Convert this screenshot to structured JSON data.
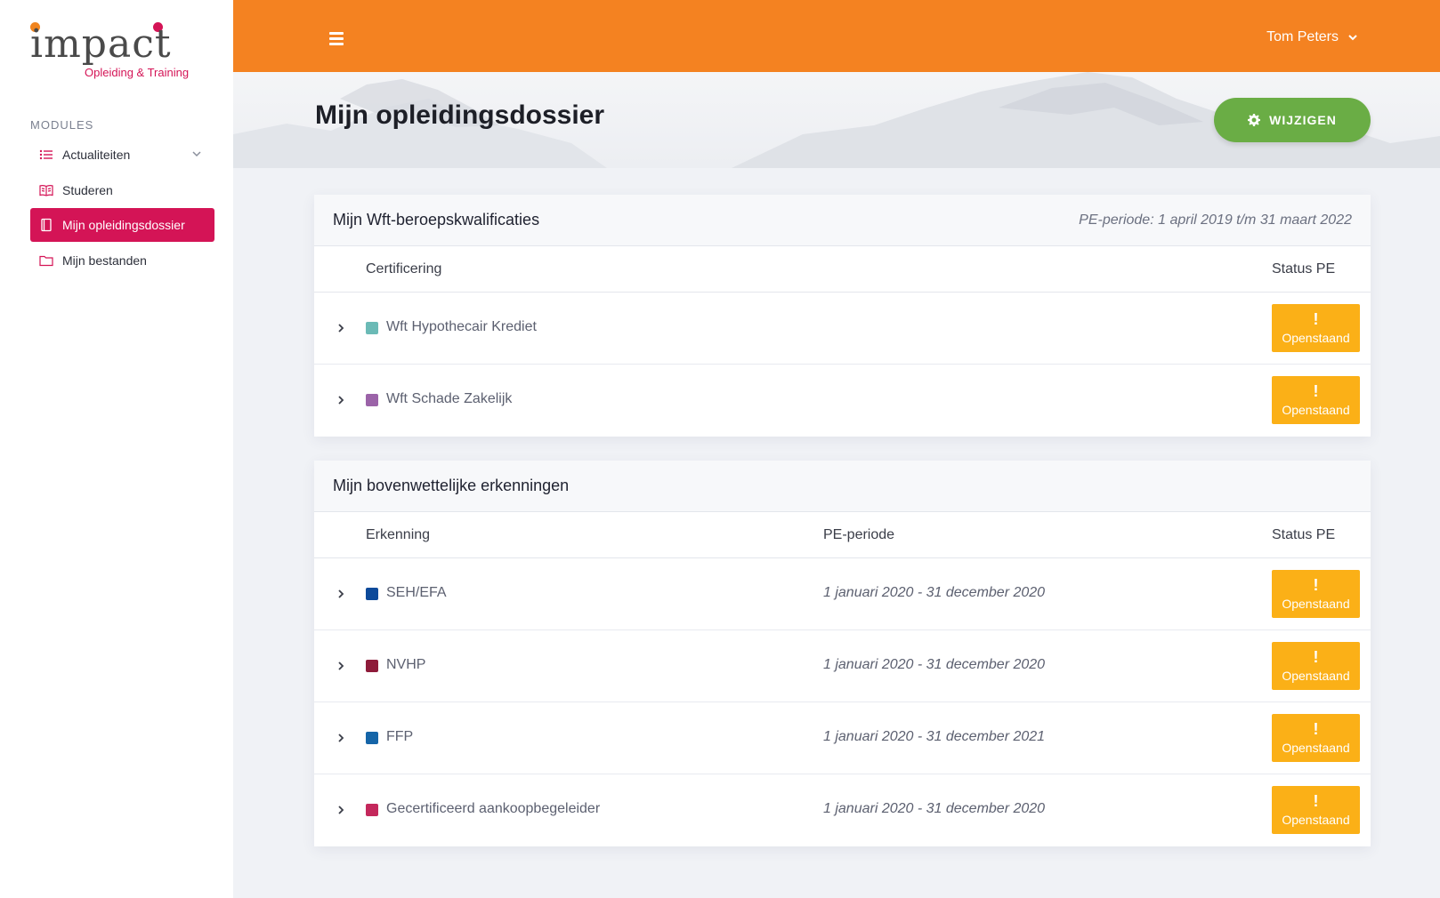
{
  "brand": {
    "logo_word": "impact",
    "logo_sub": "Opleiding & Training"
  },
  "sidebar": {
    "section_label": "MODULES",
    "items": [
      {
        "label": "Actualiteiten",
        "icon": "list-icon",
        "active": false,
        "expandable": true
      },
      {
        "label": "Studeren",
        "icon": "book-icon",
        "active": false
      },
      {
        "label": "Mijn opleidingsdossier",
        "icon": "notebook-icon",
        "active": true
      },
      {
        "label": "Mijn bestanden",
        "icon": "folder-icon",
        "active": false
      }
    ]
  },
  "topbar": {
    "user_name": "Tom Peters"
  },
  "header": {
    "title": "Mijn opleidingsdossier",
    "edit_button": "WIJZIGEN"
  },
  "qualifications": {
    "title": "Mijn Wft-beroepskwalificaties",
    "period": "PE-periode: 1 april 2019 t/m 31 maart 2022",
    "col_name": "Certificering",
    "col_status": "Status PE",
    "rows": [
      {
        "name": "Wft Hypothecair Krediet",
        "color": "#6bbab6",
        "status_icon": "!",
        "status": "Openstaand"
      },
      {
        "name": "Wft Schade Zakelijk",
        "color": "#9b63a8",
        "status_icon": "!",
        "status": "Openstaand"
      }
    ]
  },
  "recognitions": {
    "title": "Mijn bovenwettelijke erkenningen",
    "col_name": "Erkenning",
    "col_period": "PE-periode",
    "col_status": "Status PE",
    "rows": [
      {
        "name": "SEH/EFA",
        "color": "#0d4a9a",
        "period": "1 januari 2020 - 31 december 2020",
        "status_icon": "!",
        "status": "Openstaand"
      },
      {
        "name": "NVHP",
        "color": "#8e1b3a",
        "period": "1 januari 2020 - 31 december 2020",
        "status_icon": "!",
        "status": "Openstaand"
      },
      {
        "name": "FFP",
        "color": "#1565a8",
        "period": "1 januari 2020 - 31 december 2021",
        "status_icon": "!",
        "status": "Openstaand"
      },
      {
        "name": "Gecertificeerd aankoopbegeleider",
        "color": "#c4285c",
        "period": "1 januari 2020 - 31 december 2020",
        "status_icon": "!",
        "status": "Openstaand"
      }
    ]
  },
  "colors": {
    "orange": "#f48221",
    "brand_red": "#d41456",
    "green": "#6aad45",
    "status_yellow": "#fbb017"
  }
}
